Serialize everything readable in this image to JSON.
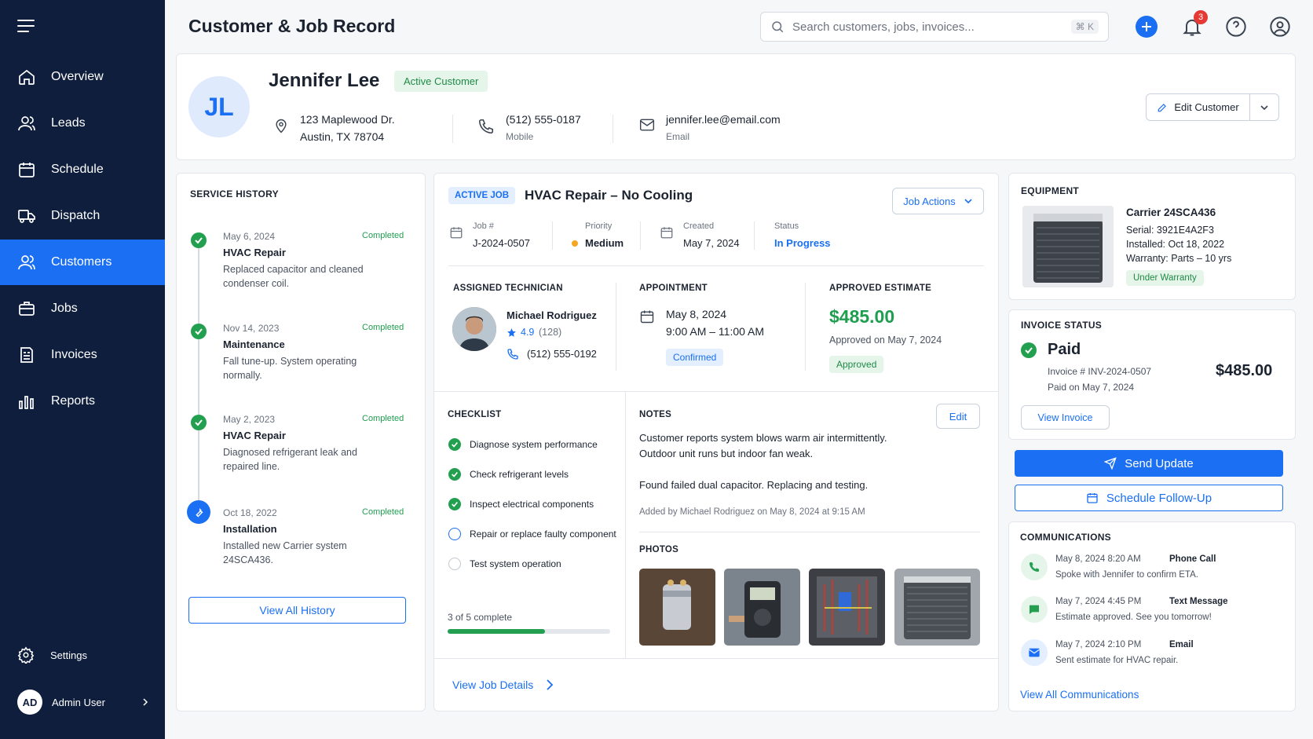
{
  "nav": {
    "items": [
      {
        "label": "Overview",
        "icon": "home-icon"
      },
      {
        "label": "Leads",
        "icon": "users-icon"
      },
      {
        "label": "Schedule",
        "icon": "calendar-icon"
      },
      {
        "label": "Dispatch",
        "icon": "truck-icon"
      },
      {
        "label": "Customers",
        "icon": "customers-icon",
        "active": true
      },
      {
        "label": "Jobs",
        "icon": "briefcase-icon"
      },
      {
        "label": "Invoices",
        "icon": "invoice-icon"
      },
      {
        "label": "Reports",
        "icon": "bar-chart-icon"
      }
    ],
    "settings": "Settings",
    "user_initials": "AD",
    "user_name": "Admin User"
  },
  "header": {
    "title": "Customer & Job Record",
    "search_placeholder": "Search customers, jobs, invoices...",
    "search_shortcut": "⌘ K",
    "notification_count": "3"
  },
  "customer": {
    "initials": "JL",
    "name": "Jennifer Lee",
    "status": "Active Customer",
    "address_line1": "123 Maplewood Dr.",
    "address_line2": "Austin, TX 78704",
    "phone": "(512) 555-0187",
    "phone_label": "Mobile",
    "email": "jennifer.lee@email.com",
    "email_label": "Email",
    "edit_label": "Edit Customer"
  },
  "service_history": {
    "title": "SERVICE HISTORY",
    "items": [
      {
        "date": "May 6, 2024",
        "status": "Completed",
        "title": "HVAC Repair",
        "desc1": "Replaced capacitor and cleaned",
        "desc2": "condenser coil."
      },
      {
        "date": "Nov 14, 2023",
        "status": "Completed",
        "title": "Maintenance",
        "desc1": "Fall tune-up. System operating",
        "desc2": "normally."
      },
      {
        "date": "May 2, 2023",
        "status": "Completed",
        "title": "HVAC Repair",
        "desc1": "Diagnosed refrigerant leak and",
        "desc2": "repaired line."
      },
      {
        "date": "Oct 18, 2022",
        "status": "Completed",
        "title": "Installation",
        "desc1": "Installed new Carrier system",
        "desc2": "24SCA436."
      }
    ],
    "view_all": "View All History"
  },
  "job": {
    "badge": "ACTIVE JOB",
    "title": "HVAC Repair – No Cooling",
    "actions_label": "Job Actions",
    "job_no_label": "Job #",
    "job_no": "J-2024-0507",
    "priority_label": "Priority",
    "priority": "Medium",
    "created_label": "Created",
    "created": "May 7, 2024",
    "status_label": "Status",
    "status": "In Progress",
    "tech_title": "ASSIGNED TECHNICIAN",
    "tech_name": "Michael Rodriguez",
    "tech_rating": "4.9",
    "tech_reviews": "(128)",
    "tech_phone": "(512) 555-0192",
    "appt_title": "APPOINTMENT",
    "appt_date": "May 8, 2024",
    "appt_time": "9:00 AM – 11:00 AM",
    "appt_status": "Confirmed",
    "estimate_title": "APPROVED ESTIMATE",
    "estimate_amount": "$485.00",
    "estimate_date": "Approved on May 7, 2024",
    "estimate_status": "Approved",
    "checklist_title": "CHECKLIST",
    "checklist": [
      {
        "label": "Diagnose system performance",
        "done": true
      },
      {
        "label": "Check refrigerant levels",
        "done": true
      },
      {
        "label": "Inspect electrical components",
        "done": true
      },
      {
        "label": "Repair or replace faulty component",
        "done": false
      },
      {
        "label": "Test system operation",
        "done": false
      }
    ],
    "progress_text": "3 of 5 complete",
    "progress_fraction": 0.6,
    "notes_title": "NOTES",
    "notes_edit": "Edit",
    "note_line1": "Customer reports system blows warm air intermittently.",
    "note_line2": "Outdoor unit runs but indoor fan weak.",
    "note_line3": "Found failed dual capacitor. Replacing and testing.",
    "note_meta": "Added by Michael Rodriguez on May 8, 2024 at 9:15 AM",
    "photos_title": "PHOTOS",
    "view_details": "View Job Details"
  },
  "equipment": {
    "title": "EQUIPMENT",
    "model": "Carrier 24SCA436",
    "serial_label": "Serial:",
    "serial": "3921E4A2F3",
    "installed_label": "Installed:",
    "installed": "Oct 18, 2022",
    "warranty_label": "Warranty:",
    "warranty": "Parts – 10 yrs",
    "warranty_status": "Under Warranty"
  },
  "invoice": {
    "title": "INVOICE STATUS",
    "status": "Paid",
    "number": "Invoice # INV-2024-0507",
    "paid_on": "Paid on May 7, 2024",
    "amount": "$485.00",
    "view_label": "View Invoice"
  },
  "actions": {
    "send_update": "Send Update",
    "schedule_followup": "Schedule Follow-Up"
  },
  "communications": {
    "title": "COMMUNICATIONS",
    "items": [
      {
        "datetime": "May 8, 2024 8:20 AM",
        "type": "Phone Call",
        "text": "Spoke with Jennifer to confirm ETA."
      },
      {
        "datetime": "May 7, 2024 4:45 PM",
        "type": "Text Message",
        "text": "Estimate approved. See you tomorrow!"
      },
      {
        "datetime": "May 7, 2024 2:10 PM",
        "type": "Email",
        "text": "Sent estimate for HVAC repair."
      }
    ],
    "view_all": "View All Communications"
  },
  "colors": {
    "sidebar": "#0f1e3d",
    "accent": "#1a6ff2",
    "success": "#22a04f",
    "priority_medium": "#f5a623"
  }
}
